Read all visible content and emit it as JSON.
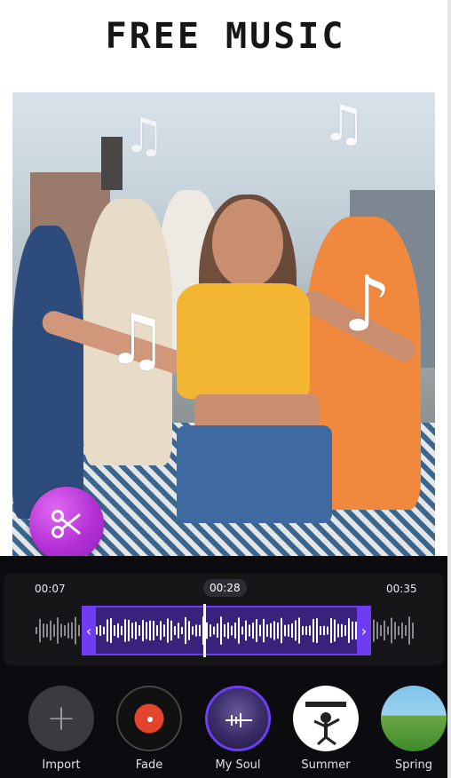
{
  "header": {
    "title": "FREE MUSIC"
  },
  "photo": {
    "description_icons": [
      "music-note-icon",
      "music-note-icon",
      "music-note-icon",
      "music-note-icon"
    ]
  },
  "editor": {
    "cut_button_icon": "scissors-icon",
    "timeline": {
      "start_time": "00:07",
      "current_time": "00:28",
      "end_time": "00:35",
      "accent_color": "#6d3cf3"
    },
    "music_list": [
      {
        "label": "Import",
        "icon": "plus-icon"
      },
      {
        "label": "Fade"
      },
      {
        "label": "My Soul",
        "selected": true
      },
      {
        "label": "Summer"
      },
      {
        "label": "Spring"
      }
    ]
  }
}
